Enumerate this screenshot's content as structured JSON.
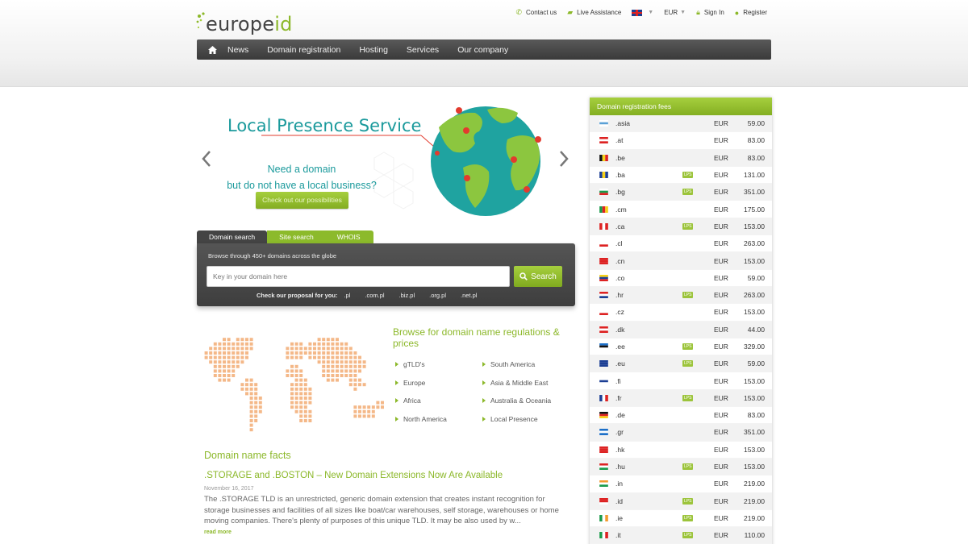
{
  "brand": {
    "part1": "europe",
    "part2": "id"
  },
  "toplinks": {
    "contact": "Contact us",
    "live": "Live Assistance",
    "currency": "EUR",
    "signin": "Sign In",
    "register": "Register"
  },
  "nav": [
    "News",
    "Domain registration",
    "Hosting",
    "Services",
    "Our company"
  ],
  "slide": {
    "title": "Local Presence Service",
    "line1": "Need a domain",
    "line2": "but do not have a local business?",
    "button": "Check out our possibilities"
  },
  "search": {
    "tabs": [
      "Domain search",
      "Site search",
      "WHOIS"
    ],
    "hint": "Browse through 450+ domains across the globe",
    "placeholder": "Key in your domain here",
    "button": "Search",
    "proposal_label": "Check our proposal for you:",
    "proposals": [
      ".pl",
      ".com.pl",
      ".biz.pl",
      ".org.pl",
      ".net.pl"
    ]
  },
  "regulations": {
    "title": "Browse for domain name regulations & prices",
    "col1": [
      "gTLD's",
      "Europe",
      "Africa",
      "North America"
    ],
    "col2": [
      "South America",
      "Asia & Middle East",
      "Australia & Oceania",
      "Local Presence"
    ]
  },
  "facts": {
    "heading": "Domain name facts",
    "title": ".STORAGE and .BOSTON – New Domain Extensions Now Are Available",
    "date": "November 16, 2017",
    "text": "The .STORAGE TLD is an unrestricted, generic domain extension that creates instant recognition for storage businesses and facilities of all sizes like boat/car warehouses, self storage, warehouses or home moving companies. There's plenty of purposes of this unique TLD. It may be also used by w...",
    "more": "read more"
  },
  "fees": {
    "title": "Domain registration fees",
    "lps_label": "LPS",
    "rows": [
      {
        "tld": ".asia",
        "lps": false,
        "cur": "EUR",
        "price": "59.00"
      },
      {
        "tld": ".at",
        "lps": false,
        "cur": "EUR",
        "price": "83.00"
      },
      {
        "tld": ".be",
        "lps": false,
        "cur": "EUR",
        "price": "83.00"
      },
      {
        "tld": ".ba",
        "lps": true,
        "cur": "EUR",
        "price": "131.00"
      },
      {
        "tld": ".bg",
        "lps": true,
        "cur": "EUR",
        "price": "351.00"
      },
      {
        "tld": ".cm",
        "lps": false,
        "cur": "EUR",
        "price": "175.00"
      },
      {
        "tld": ".ca",
        "lps": true,
        "cur": "EUR",
        "price": "153.00"
      },
      {
        "tld": ".cl",
        "lps": false,
        "cur": "EUR",
        "price": "263.00"
      },
      {
        "tld": ".cn",
        "lps": false,
        "cur": "EUR",
        "price": "153.00"
      },
      {
        "tld": ".co",
        "lps": false,
        "cur": "EUR",
        "price": "59.00"
      },
      {
        "tld": ".hr",
        "lps": true,
        "cur": "EUR",
        "price": "263.00"
      },
      {
        "tld": ".cz",
        "lps": false,
        "cur": "EUR",
        "price": "153.00"
      },
      {
        "tld": ".dk",
        "lps": false,
        "cur": "EUR",
        "price": "44.00"
      },
      {
        "tld": ".ee",
        "lps": true,
        "cur": "EUR",
        "price": "329.00"
      },
      {
        "tld": ".eu",
        "lps": true,
        "cur": "EUR",
        "price": "59.00"
      },
      {
        "tld": ".fi",
        "lps": false,
        "cur": "EUR",
        "price": "153.00"
      },
      {
        "tld": ".fr",
        "lps": true,
        "cur": "EUR",
        "price": "153.00"
      },
      {
        "tld": ".de",
        "lps": false,
        "cur": "EUR",
        "price": "83.00"
      },
      {
        "tld": ".gr",
        "lps": false,
        "cur": "EUR",
        "price": "351.00"
      },
      {
        "tld": ".hk",
        "lps": false,
        "cur": "EUR",
        "price": "153.00"
      },
      {
        "tld": ".hu",
        "lps": true,
        "cur": "EUR",
        "price": "153.00"
      },
      {
        "tld": ".in",
        "lps": false,
        "cur": "EUR",
        "price": "219.00"
      },
      {
        "tld": ".id",
        "lps": true,
        "cur": "EUR",
        "price": "219.00"
      },
      {
        "tld": ".ie",
        "lps": true,
        "cur": "EUR",
        "price": "219.00"
      },
      {
        "tld": ".it",
        "lps": true,
        "cur": "EUR",
        "price": "110.00"
      }
    ]
  },
  "colors": {
    "accent": "#8cb82a",
    "teal": "#1b9a9c",
    "nav": "#444444",
    "map_dots": "#f4b888"
  }
}
